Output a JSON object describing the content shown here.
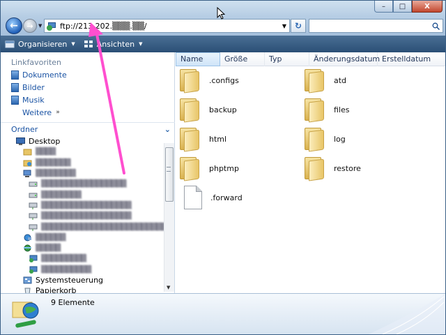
{
  "window": {
    "minimize": "–",
    "maximize": "□",
    "close": "X"
  },
  "nav": {
    "back": "←",
    "forward": "→",
    "dropdown": "▼"
  },
  "address": {
    "value": "ftp://213.202.▒▒▒.▒▒/",
    "dropdown": "▼",
    "refresh": "↻"
  },
  "search": {
    "icon": "search-icon",
    "glyph": "⌕"
  },
  "toolbar": {
    "organize": "Organisieren",
    "views": "Ansichten",
    "arrow": "▼"
  },
  "navpane": {
    "favorites_title": "Linkfavoriten",
    "favorites": [
      {
        "label": "Dokumente"
      },
      {
        "label": "Bilder"
      },
      {
        "label": "Musik"
      }
    ],
    "more": "Weitere",
    "more_chevron": "»",
    "folders_title": "Ordner",
    "folders_chevron": "⌄",
    "tree": [
      {
        "label": "Desktop",
        "blur": false
      },
      {
        "label": "▒▒▒▒",
        "blur": true
      },
      {
        "label": "▒▒▒▒▒▒▒",
        "blur": true
      },
      {
        "label": "▒▒▒▒▒▒▒▒",
        "blur": true
      },
      {
        "label": "▒▒▒▒▒▒▒▒▒▒▒▒▒▒▒▒▒",
        "blur": true
      },
      {
        "label": "▒▒▒▒▒▒▒▒",
        "blur": true
      },
      {
        "label": "▒▒▒▒▒▒▒▒▒▒▒▒▒▒▒▒▒▒",
        "blur": true
      },
      {
        "label": "▒▒▒▒▒▒▒▒▒▒▒▒▒▒▒▒▒▒",
        "blur": true
      },
      {
        "label": "▒▒▒▒▒▒▒▒▒▒▒▒▒▒▒▒▒▒▒▒▒▒▒▒▒▒▒▒▒▒",
        "blur": true
      },
      {
        "label": "▒▒▒▒▒▒",
        "blur": true
      },
      {
        "label": "▒▒▒▒▒",
        "blur": true
      },
      {
        "label": "▒▒▒▒▒▒▒▒▒",
        "blur": true
      },
      {
        "label": "▒▒▒▒▒▒▒▒▒▒",
        "blur": true
      },
      {
        "label": "Systemsteuerung",
        "blur": false
      },
      {
        "label": "Papierkorb",
        "blur": false
      }
    ],
    "scroll_down": "▼"
  },
  "columns": [
    "Name",
    "Größe",
    "Typ",
    "Änderungsdatum",
    "Erstelldatum"
  ],
  "items": [
    {
      "name": ".configs",
      "kind": "folder"
    },
    {
      "name": "atd",
      "kind": "folder"
    },
    {
      "name": "backup",
      "kind": "folder"
    },
    {
      "name": "files",
      "kind": "folder"
    },
    {
      "name": "html",
      "kind": "folder"
    },
    {
      "name": "log",
      "kind": "folder"
    },
    {
      "name": "phptmp",
      "kind": "folder"
    },
    {
      "name": "restore",
      "kind": "folder"
    },
    {
      "name": ".forward",
      "kind": "file"
    }
  ],
  "status": {
    "count": "9 Elemente"
  },
  "colors": {
    "annotation": "#ff4fcf",
    "link": "#1a53a3"
  }
}
